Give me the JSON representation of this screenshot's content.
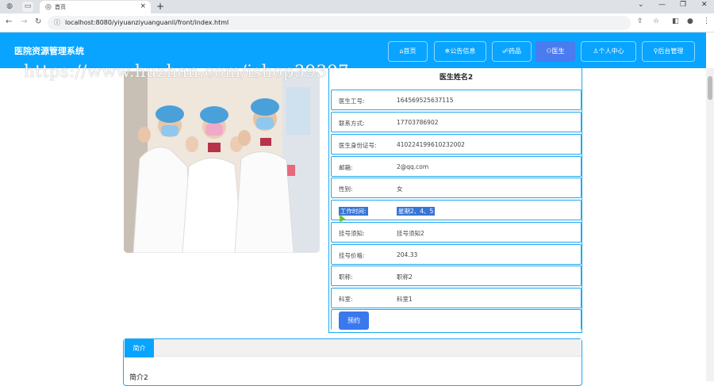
{
  "browser": {
    "tab_title": "首页",
    "url": "localhost:8080/yiyuanziyuanguanli/front/index.html"
  },
  "site": {
    "brand": "医院资源管理系统",
    "watermark": "https://www.huzhan.com/ishop39397",
    "menu": [
      {
        "label": "首页",
        "icon": "home-icon"
      },
      {
        "label": "公告信息",
        "icon": "snowflake-icon"
      },
      {
        "label": "药品",
        "icon": "pill-icon"
      },
      {
        "label": "医生",
        "icon": "doctor-icon"
      },
      {
        "label": "个人中心",
        "icon": "user-icon"
      },
      {
        "label": "后台管理",
        "icon": "link-icon"
      }
    ],
    "active_menu": "医生"
  },
  "doctor": {
    "name": "医生姓名2",
    "rows": [
      {
        "label": "医生工号:",
        "value": "164569525637115"
      },
      {
        "label": "联系方式:",
        "value": "17703786902"
      },
      {
        "label": "医生身份证号:",
        "value": "410224199610232002"
      },
      {
        "label": "邮箱:",
        "value": "2@qq.com"
      },
      {
        "label": "性别:",
        "value": "女"
      },
      {
        "label": "工作时间:",
        "value": "星期2、4、5"
      },
      {
        "label": "挂号须知:",
        "value": "挂号须知2"
      },
      {
        "label": "挂号价格:",
        "value": "204.33"
      },
      {
        "label": "职称:",
        "value": "职称2"
      },
      {
        "label": "科室:",
        "value": "科室1"
      }
    ],
    "book_label": "预约"
  },
  "intro": {
    "tab_label": "简介",
    "text": "简介2"
  },
  "colors": {
    "header": "#09a4ff",
    "active_menu": "#4a7bef",
    "border": "#1fa8f0",
    "button": "#3a78ee"
  }
}
